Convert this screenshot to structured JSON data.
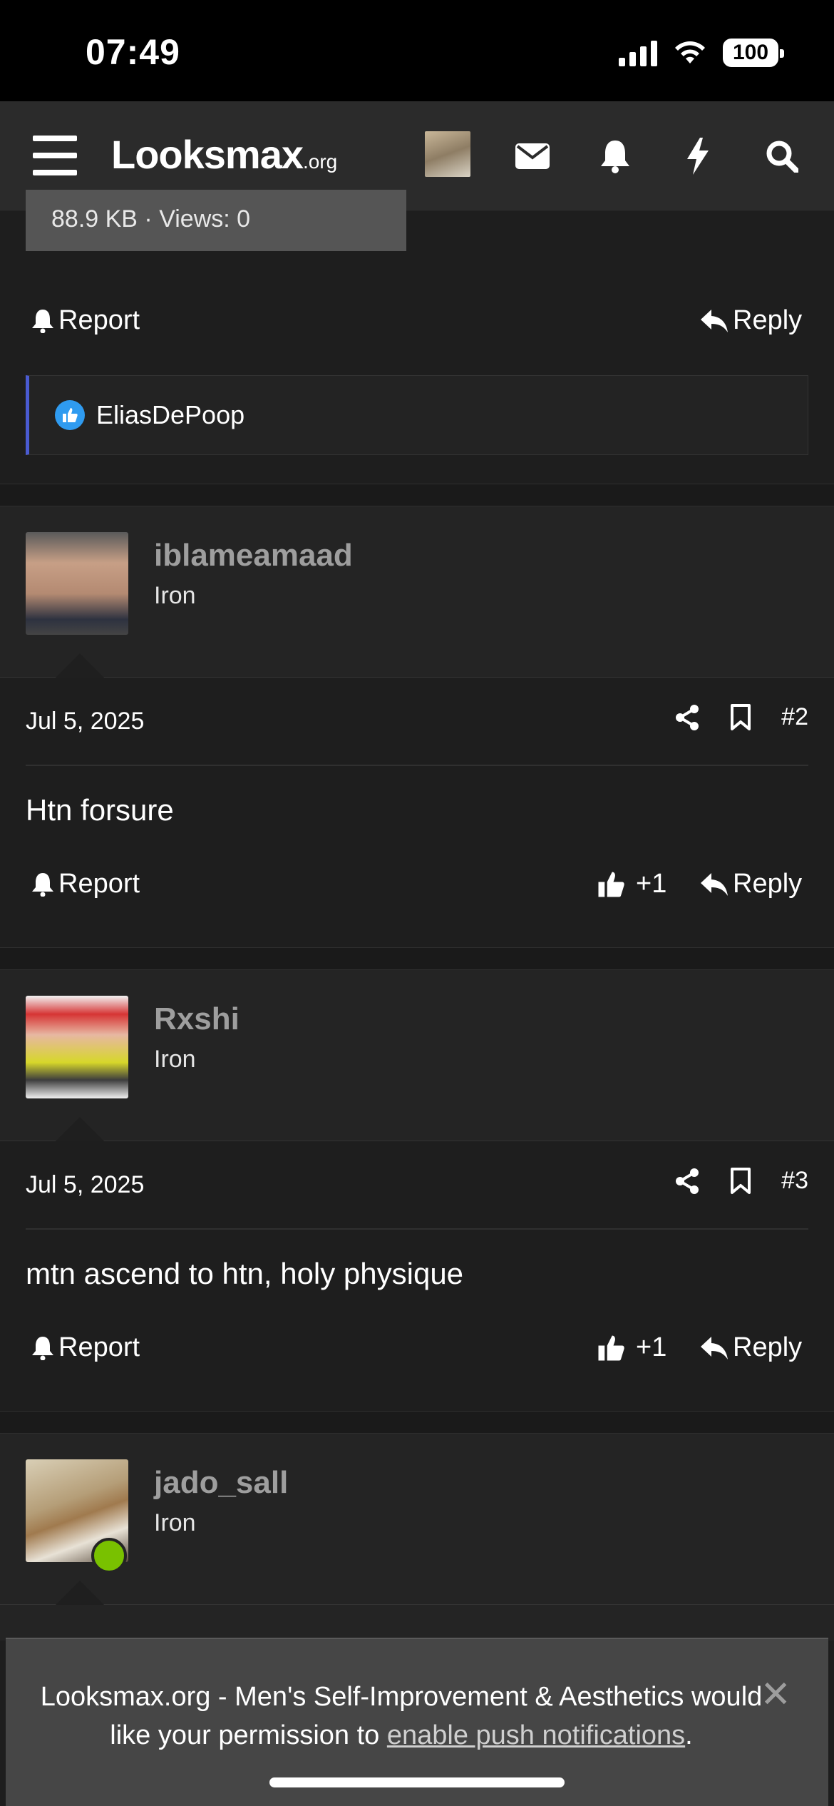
{
  "status_bar": {
    "time": "07:49",
    "battery": "100"
  },
  "header": {
    "logo": "Looksmax",
    "logo_suffix": ".org",
    "icons": [
      "menu-icon",
      "avatar",
      "envelope-icon",
      "bell-icon",
      "bolt-icon",
      "search-icon"
    ]
  },
  "top_post": {
    "attachment_meta": "88.9 KB · Views: 0",
    "report_label": "Report",
    "reply_label": "Reply",
    "reactor": "EliasDePoop"
  },
  "posts": [
    {
      "username": "iblameamaad",
      "user_title": "Iron",
      "date": "Jul 5, 2025",
      "number": "#2",
      "text": "Htn forsure",
      "report_label": "Report",
      "reaction_count": "+1",
      "reply_label": "Reply"
    },
    {
      "username": "Rxshi",
      "user_title": "Iron",
      "date": "Jul 5, 2025",
      "number": "#3",
      "text": "mtn ascend to htn, holy physique",
      "report_label": "Report",
      "reaction_count": "+1",
      "reply_label": "Reply"
    },
    {
      "username": "jado_sall",
      "user_title": "Iron",
      "online": true
    }
  ],
  "push_banner": {
    "text_before": "Looksmax.org - Men's Self-Improvement & Aesthetics would like your permission to ",
    "link": "enable push notifications",
    "text_after": ".",
    "close": "✕"
  },
  "colors": {
    "background": "#1e1e1e",
    "header": "#2b2b2b",
    "reaction_accent": "#4a5bd1",
    "like_badge": "#2f9bf0",
    "online": "#79c100",
    "username": "#9e9e9e"
  }
}
